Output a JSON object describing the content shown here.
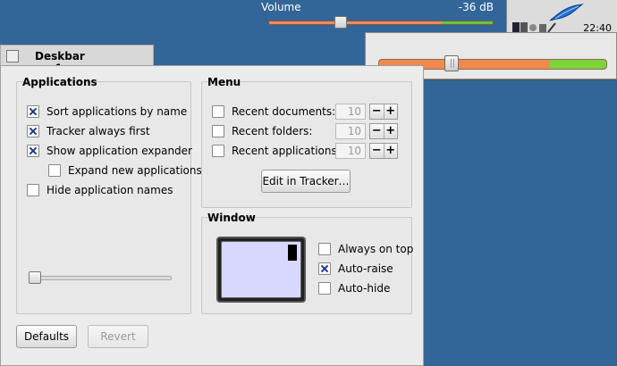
{
  "volume_bar": {
    "label": "Volume",
    "value_text": "-36 dB",
    "level_fraction": 0.31,
    "low_color": "#f08a5a",
    "high_color": "#60c838"
  },
  "deskbar": {
    "clock": "22:40",
    "logo_icon": "blue-leaf-icon",
    "tray_icon": "system-tray-icon"
  },
  "volume_popup": {
    "level_fraction": 0.31
  },
  "window": {
    "title": "Deskbar preferences",
    "applications": {
      "title": "Applications",
      "options": [
        {
          "label": "Sort applications by name",
          "checked": true
        },
        {
          "label": "Tracker always first",
          "checked": true
        },
        {
          "label": "Show application expander",
          "checked": true
        },
        {
          "label": "Expand new applications",
          "checked": false
        },
        {
          "label": "Hide application names",
          "checked": false
        }
      ],
      "icon_size_fraction": 0.0
    },
    "menu": {
      "title": "Menu",
      "rows": [
        {
          "label": "Recent documents:",
          "checked": false,
          "value": "10"
        },
        {
          "label": "Recent folders:",
          "checked": false,
          "value": "10"
        },
        {
          "label": "Recent applications:",
          "checked": false,
          "value": "10"
        }
      ],
      "minus": "−",
      "plus": "+",
      "edit_button": "Edit in Tracker…"
    },
    "window_section": {
      "title": "Window",
      "options": [
        {
          "label": "Always on top",
          "checked": false
        },
        {
          "label": "Auto-raise",
          "checked": true
        },
        {
          "label": "Auto-hide",
          "checked": false
        }
      ]
    },
    "buttons": {
      "defaults": "Defaults",
      "revert": "Revert"
    }
  }
}
